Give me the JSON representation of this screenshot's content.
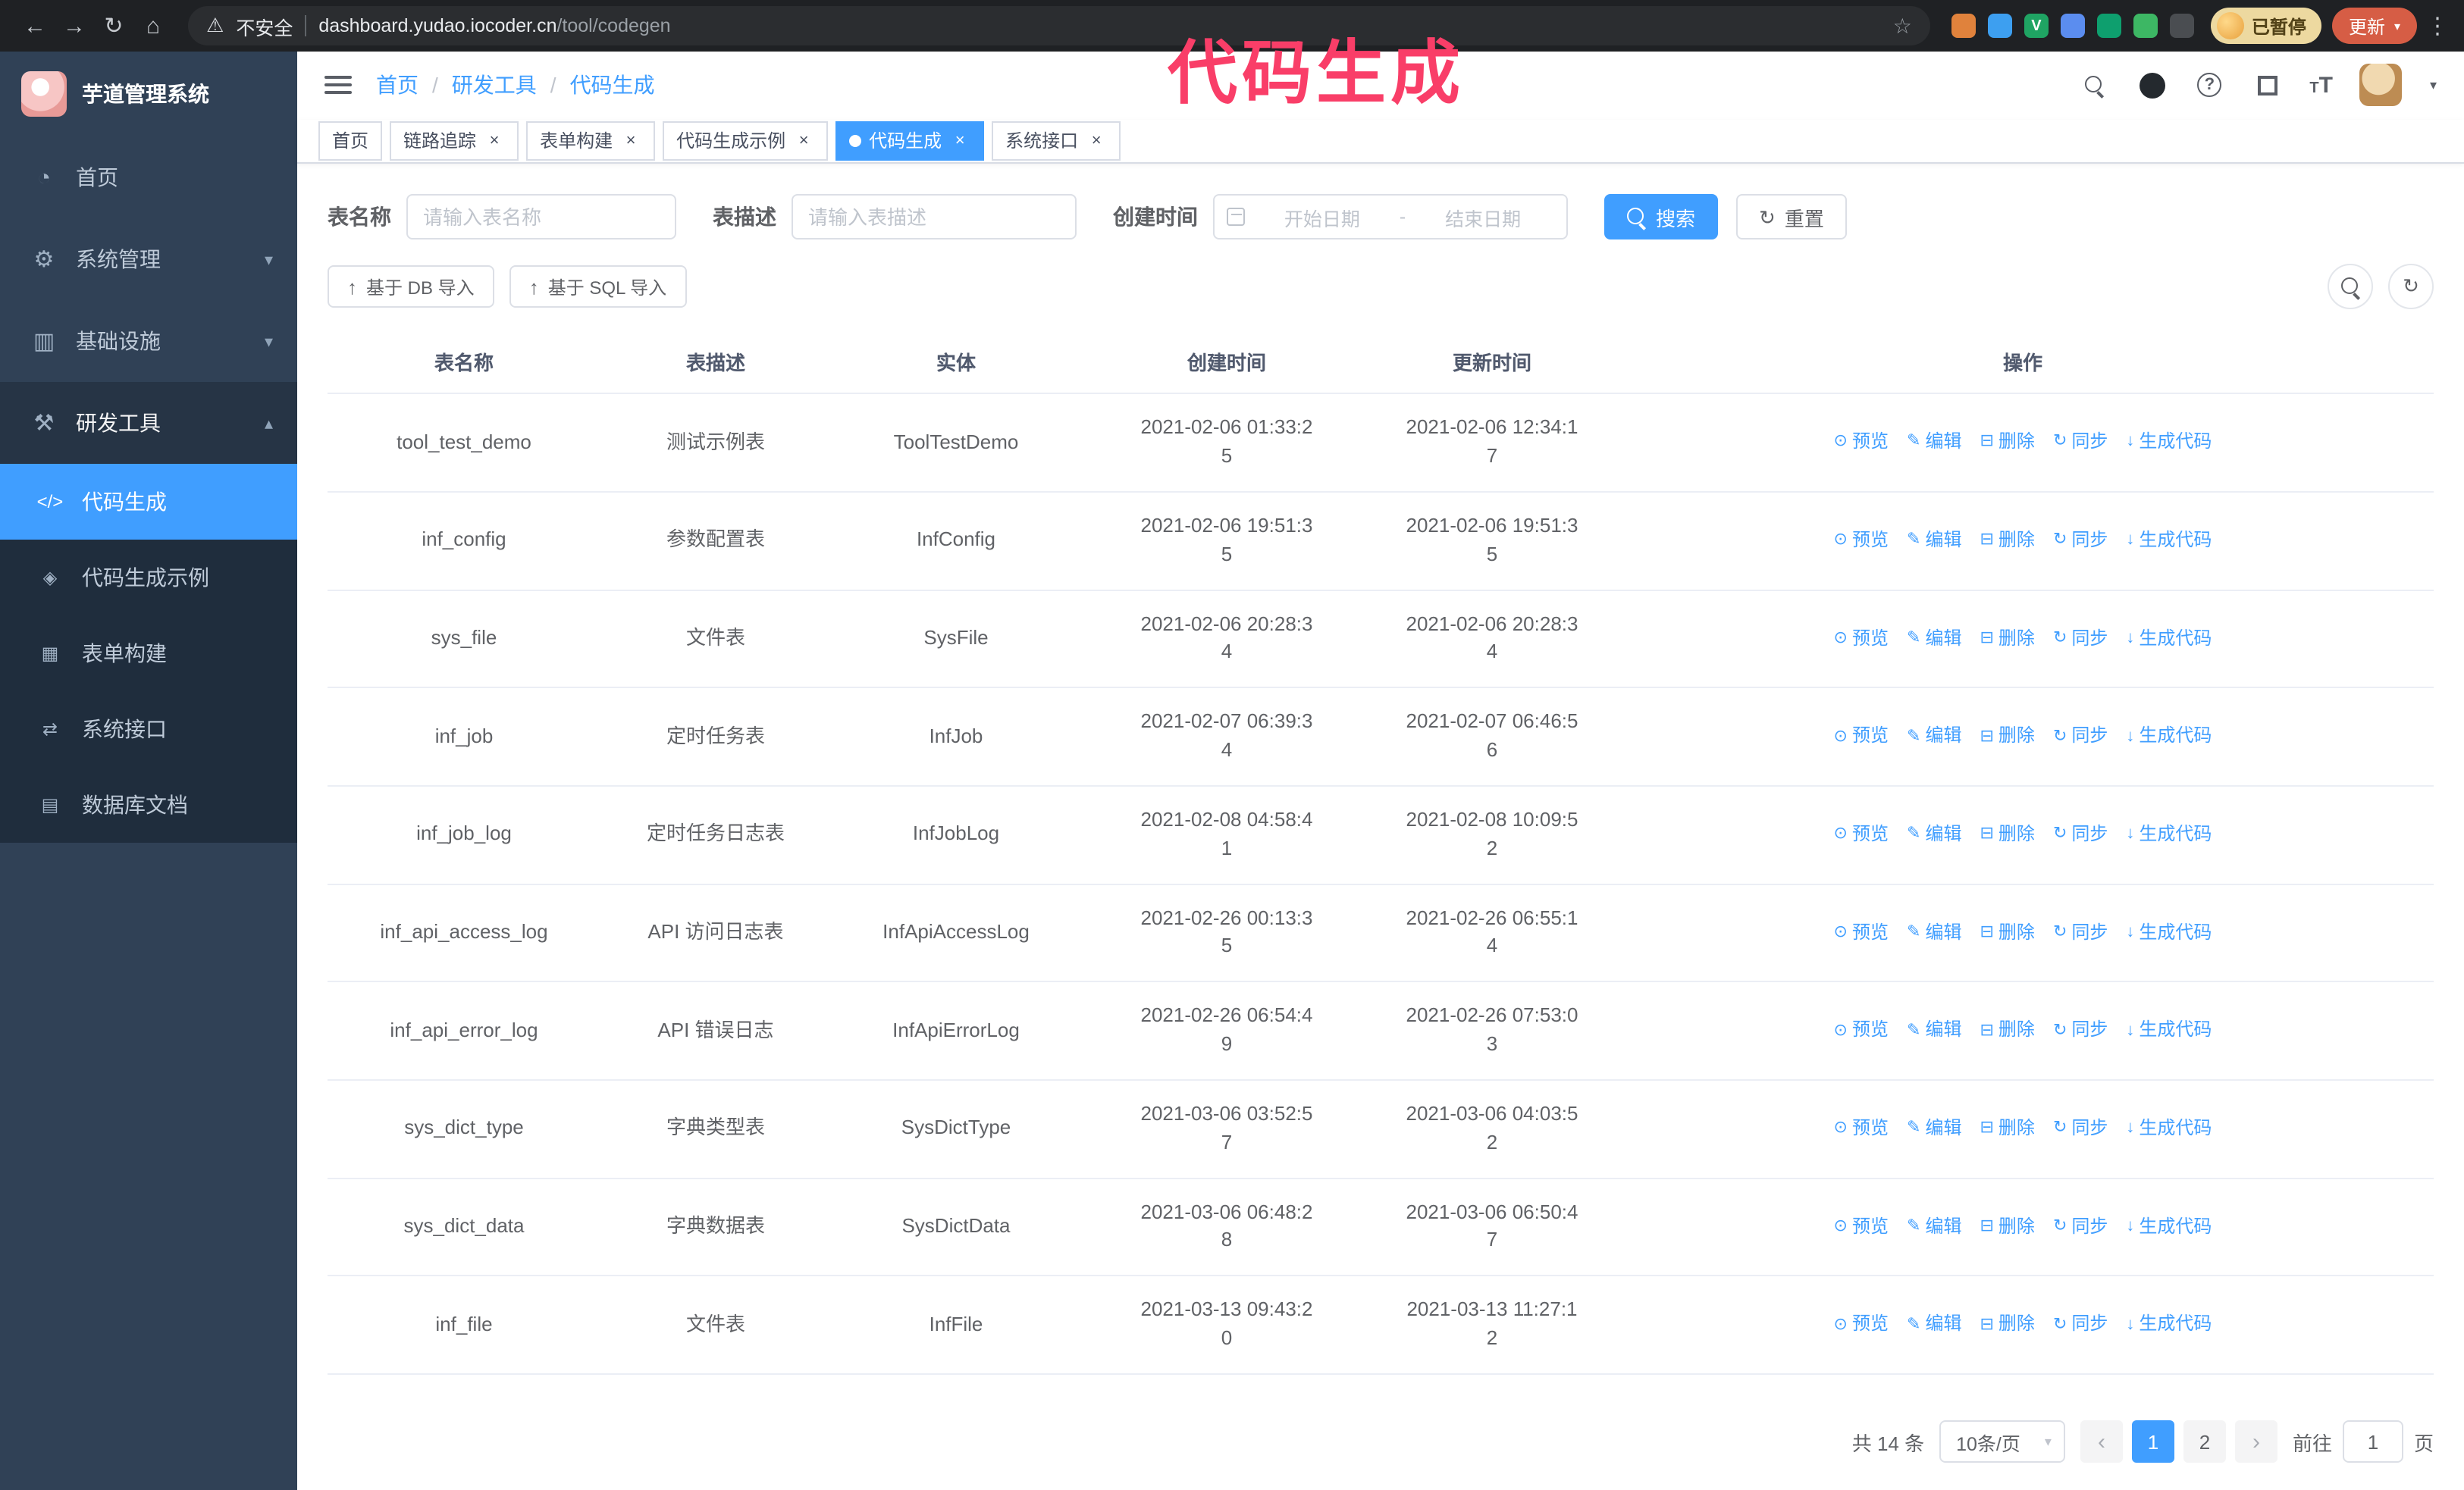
{
  "colors": {
    "accent": "#409eff",
    "annotation": "#f93e68",
    "sidebar": "#304156",
    "submenu": "#1f2d3d",
    "update": "#d65d45",
    "badge": "#edd9a0"
  },
  "icons": {
    "back": "←",
    "forward": "→",
    "reload": "↻",
    "home": "⌂",
    "warning": "⚠",
    "star": "☆",
    "kebab": "⋮",
    "close": "×",
    "dashboard": "◔",
    "gear": "⚙",
    "infra": "▥",
    "tools": "⚒",
    "code": "</>",
    "shield": "◈",
    "form": "▦",
    "api": "⇄",
    "db": "▤",
    "down": "▾",
    "up": "▴",
    "caret": "▾",
    "eye": "⊙",
    "edit": "✎",
    "trash": "⊟",
    "sync": "↻",
    "generate": "↓",
    "upload": "↑",
    "refresh": "↻",
    "prev": "‹",
    "next": "›",
    "t_small": "T",
    "t_big": "T",
    "question": "?"
  },
  "annotation": "代码生成",
  "browser": {
    "security_label": "不安全",
    "url_host": "dashboard.yudao.iocoder.cn",
    "url_path": "/tool/codegen",
    "extensions": [
      {
        "name": "fox-extension",
        "color": "#e0823c",
        "glyph": ""
      },
      {
        "name": "drop-extension",
        "color": "#3d9ff0",
        "glyph": ""
      },
      {
        "name": "v-extension",
        "color": "#1fa463",
        "glyph": "V"
      },
      {
        "name": "share-extension",
        "color": "#5b8def",
        "glyph": ""
      },
      {
        "name": "card-extension",
        "color": "#0e9f6e",
        "glyph": ""
      },
      {
        "name": "leaf-extension",
        "color": "#3db764",
        "glyph": ""
      },
      {
        "name": "puzzle-extension",
        "color": "#4a4d51",
        "glyph": ""
      }
    ],
    "profile_badge": "已暂停",
    "update_button": "更新"
  },
  "sidebar": {
    "logo_title": "芋道管理系统",
    "menu": [
      {
        "label": "首页",
        "icon": "dashboard",
        "chevron": null
      },
      {
        "label": "系统管理",
        "icon": "gear",
        "chevron": "down"
      },
      {
        "label": "基础设施",
        "icon": "infra",
        "chevron": "down"
      },
      {
        "label": "研发工具",
        "icon": "tools",
        "chevron": "up",
        "expanded": true
      }
    ],
    "submenu": [
      {
        "label": "代码生成",
        "icon": "code",
        "active": true
      },
      {
        "label": "代码生成示例",
        "icon": "shield"
      },
      {
        "label": "表单构建",
        "icon": "form"
      },
      {
        "label": "系统接口",
        "icon": "api"
      },
      {
        "label": "数据库文档",
        "icon": "db"
      }
    ]
  },
  "header": {
    "separator": "/",
    "breadcrumb": [
      {
        "label": "首页"
      },
      {
        "label": "研发工具",
        "sep": true
      },
      {
        "label": "代码生成",
        "sep": true
      }
    ]
  },
  "tabs": [
    {
      "label": "首页"
    },
    {
      "label": "链路追踪",
      "closable": true
    },
    {
      "label": "表单构建",
      "closable": true
    },
    {
      "label": "代码生成示例",
      "closable": true
    },
    {
      "label": "代码生成",
      "closable": true,
      "active": true
    },
    {
      "label": "系统接口",
      "closable": true
    }
  ],
  "filters": {
    "name_label": "表名称",
    "name_placeholder": "请输入表名称",
    "desc_label": "表描述",
    "desc_placeholder": "请输入表描述",
    "time_label": "创建时间",
    "start_placeholder": "开始日期",
    "range_separator": "-",
    "end_placeholder": "结束日期",
    "search_label": "搜索",
    "reset_label": "重置"
  },
  "toolbar": {
    "import_db_label": "基于 DB 导入",
    "import_sql_label": "基于 SQL 导入"
  },
  "table": {
    "columns": [
      "表名称",
      "表描述",
      "实体",
      "创建时间",
      "更新时间",
      "操作"
    ],
    "actions": [
      {
        "label": "预览",
        "icon": "eye"
      },
      {
        "label": "编辑",
        "icon": "edit"
      },
      {
        "label": "删除",
        "icon": "trash"
      },
      {
        "label": "同步",
        "icon": "sync"
      },
      {
        "label": "生成代码",
        "icon": "generate"
      }
    ],
    "rows": [
      {
        "name": "tool_test_demo",
        "desc": "测试示例表",
        "entity": "ToolTestDemo",
        "created": "2021-02-06 01:33:25",
        "updated": "2021-02-06 12:34:17"
      },
      {
        "name": "inf_config",
        "desc": "参数配置表",
        "entity": "InfConfig",
        "created": "2021-02-06 19:51:35",
        "updated": "2021-02-06 19:51:35"
      },
      {
        "name": "sys_file",
        "desc": "文件表",
        "entity": "SysFile",
        "created": "2021-02-06 20:28:34",
        "updated": "2021-02-06 20:28:34"
      },
      {
        "name": "inf_job",
        "desc": "定时任务表",
        "entity": "InfJob",
        "created": "2021-02-07 06:39:34",
        "updated": "2021-02-07 06:46:56"
      },
      {
        "name": "inf_job_log",
        "desc": "定时任务日志表",
        "entity": "InfJobLog",
        "created": "2021-02-08 04:58:41",
        "updated": "2021-02-08 10:09:52"
      },
      {
        "name": "inf_api_access_log",
        "desc": "API 访问日志表",
        "entity": "InfApiAccessLog",
        "created": "2021-02-26 00:13:35",
        "updated": "2021-02-26 06:55:14"
      },
      {
        "name": "inf_api_error_log",
        "desc": "API 错误日志",
        "entity": "InfApiErrorLog",
        "created": "2021-02-26 06:54:49",
        "updated": "2021-02-26 07:53:03"
      },
      {
        "name": "sys_dict_type",
        "desc": "字典类型表",
        "entity": "SysDictType",
        "created": "2021-03-06 03:52:57",
        "updated": "2021-03-06 04:03:52"
      },
      {
        "name": "sys_dict_data",
        "desc": "字典数据表",
        "entity": "SysDictData",
        "created": "2021-03-06 06:48:28",
        "updated": "2021-03-06 06:50:47"
      },
      {
        "name": "inf_file",
        "desc": "文件表",
        "entity": "InfFile",
        "created": "2021-03-13 09:43:20",
        "updated": "2021-03-13 11:27:12"
      }
    ]
  },
  "pagination": {
    "total": "共 14 条",
    "page_size": "10条/页",
    "pages": [
      {
        "label": "1",
        "active": true
      },
      {
        "label": "2"
      }
    ],
    "goto_label": "前往",
    "goto_value": "1",
    "goto_unit": "页"
  }
}
